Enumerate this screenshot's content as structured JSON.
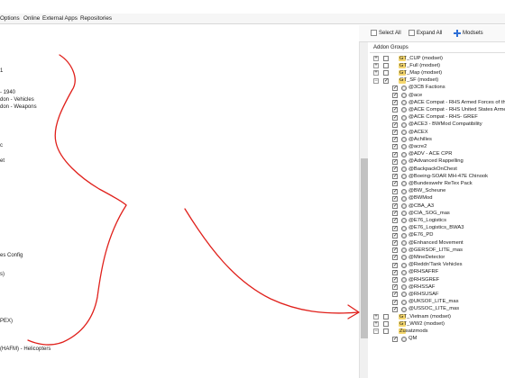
{
  "menubar": {
    "items": [
      {
        "label": "Options"
      },
      {
        "label": "Online"
      },
      {
        "label": "External Apps"
      },
      {
        "label": "Repositories"
      }
    ]
  },
  "left_pane": {
    "rows": [
      {
        "text": "1"
      },
      {
        "text": "- 1940"
      },
      {
        "text": "don - Vehicles"
      },
      {
        "text": "don - Weapons"
      },
      {
        "text": "c"
      },
      {
        "text": "et"
      },
      {
        "text": "es Config"
      },
      {
        "text": "s)"
      },
      {
        "text": "PEX)"
      },
      {
        "text": "(HAFM) - Helicopters"
      }
    ]
  },
  "toolbar": {
    "select_all": "Select All",
    "expand_all": "Expand All",
    "modsets": "Modsets"
  },
  "addon_groups": {
    "header": "Addon Groups",
    "items": [
      {
        "label": "GT_CUP (modset)",
        "kind": "group",
        "expanded": false,
        "checked": false
      },
      {
        "label": "GT_Full (modset)",
        "kind": "group",
        "expanded": false,
        "checked": false
      },
      {
        "label": "GT_Map (modset)",
        "kind": "group",
        "expanded": false,
        "checked": false
      },
      {
        "label": "GT_SF (modset)",
        "kind": "group",
        "expanded": true,
        "checked": true
      },
      {
        "label": "@3CB Factions",
        "kind": "addon",
        "checked": true
      },
      {
        "label": "@ace",
        "kind": "addon",
        "checked": true
      },
      {
        "label": "@ACE Compat - RHS Armed Forces of the",
        "kind": "addon",
        "checked": true
      },
      {
        "label": "@ACE Compat - RHS United States Armed",
        "kind": "addon",
        "checked": true
      },
      {
        "label": "@ACE Compat - RHS- GREF",
        "kind": "addon",
        "checked": true
      },
      {
        "label": "@ACE3 - BWMod Compatibility",
        "kind": "addon",
        "checked": true
      },
      {
        "label": "@ACEX",
        "kind": "addon",
        "checked": true
      },
      {
        "label": "@Achilles",
        "kind": "addon",
        "checked": true
      },
      {
        "label": "@acre2",
        "kind": "addon",
        "checked": true
      },
      {
        "label": "@ADV - ACE CPR",
        "kind": "addon",
        "checked": true
      },
      {
        "label": "@Advanced Rappelling",
        "kind": "addon",
        "checked": true
      },
      {
        "label": "@BackpackOnChest",
        "kind": "addon",
        "checked": true
      },
      {
        "label": "@Boeing-SOAR MH-47E Chinook",
        "kind": "addon",
        "checked": true
      },
      {
        "label": "@Bundeswehr ReTex Pack",
        "kind": "addon",
        "checked": true
      },
      {
        "label": "@BW_Scheune",
        "kind": "addon",
        "checked": true
      },
      {
        "label": "@BWMod",
        "kind": "addon",
        "checked": true
      },
      {
        "label": "@CBA_A3",
        "kind": "addon",
        "checked": true
      },
      {
        "label": "@CIA_SOG_mas",
        "kind": "addon",
        "checked": true
      },
      {
        "label": "@E76_Logistics",
        "kind": "addon",
        "checked": true
      },
      {
        "label": "@E76_Logistics_BWA3",
        "kind": "addon",
        "checked": true
      },
      {
        "label": "@E76_PD",
        "kind": "addon",
        "checked": true
      },
      {
        "label": "@Enhanced Movement",
        "kind": "addon",
        "checked": true
      },
      {
        "label": "@GERSOF_LITE_mas",
        "kind": "addon",
        "checked": true
      },
      {
        "label": "@MineDetector",
        "kind": "addon",
        "checked": true
      },
      {
        "label": "@Reddn'Tank Vehicles",
        "kind": "addon",
        "checked": true
      },
      {
        "label": "@RHSAFRF",
        "kind": "addon",
        "checked": true
      },
      {
        "label": "@RHSGREF",
        "kind": "addon",
        "checked": true
      },
      {
        "label": "@RHSSAF",
        "kind": "addon",
        "checked": true
      },
      {
        "label": "@RHSUSAF",
        "kind": "addon",
        "checked": true
      },
      {
        "label": "@UKSOF_LITE_mas",
        "kind": "addon",
        "checked": true
      },
      {
        "label": "@USSOC_LITE_mas",
        "kind": "addon",
        "checked": true
      },
      {
        "label": "GT_Vietnam (modset)",
        "kind": "group",
        "expanded": false,
        "checked": false
      },
      {
        "label": "GT_WW2 (modset)",
        "kind": "group",
        "expanded": false,
        "checked": false
      },
      {
        "label": "Zusatzmods",
        "kind": "group",
        "expanded": true,
        "checked": false
      },
      {
        "label": "QM",
        "kind": "addon",
        "checked": true
      }
    ]
  },
  "icons": {
    "modsets_icon": "plus-icon",
    "group_icon": "folder-icon",
    "addon_icon": "gear-icon"
  },
  "colors": {
    "annotation": "#e0201b",
    "folder": "#f5d76e",
    "modsets_plus": "#2e6fd6"
  }
}
